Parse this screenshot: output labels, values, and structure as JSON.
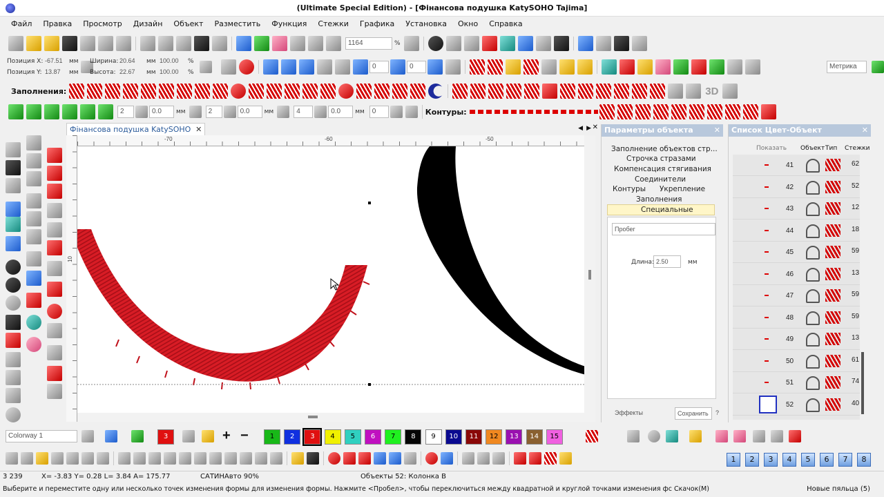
{
  "app": {
    "title": "(Ultimate Special Edition) - [Фінансова подушка KatySOHO        Tajima]"
  },
  "menu": [
    "Файл",
    "Правка",
    "Просмотр",
    "Дизайн",
    "Объект",
    "Разместить",
    "Функция",
    "Стежки",
    "Графика",
    "Установка",
    "Окно",
    "Справка"
  ],
  "toolbar1": {
    "zoom_value": "1164",
    "zoom_unit": "%"
  },
  "toolbar2": {
    "pos_x_label": "Позиция X:",
    "pos_x": "-67.51",
    "pos_x_unit": "мм",
    "pos_y_label": "Позиция Y:",
    "pos_y": "13.87",
    "pos_y_unit": "мм",
    "width_label": "Ширина:",
    "width": "20.64",
    "width_unit": "мм",
    "width_pct": "100.00",
    "width_pct_unit": "%",
    "height_label": "Высота:",
    "height": "22.67",
    "height_unit": "мм",
    "height_pct": "100.00",
    "height_pct_unit": "%",
    "rotate_value": "0",
    "slant_value": "0",
    "units_select": "Метрика"
  },
  "toolbar3": {
    "fills_label": "Заполнения:",
    "label_3d": "3D"
  },
  "toolbar4": {
    "field1": "2",
    "field2": "0.0",
    "field2_unit": "мм",
    "field3": "2",
    "field4": "0.0",
    "field4_unit": "мм",
    "field5": "4",
    "field6": "0.0",
    "field6_unit": "мм",
    "field7": "0",
    "contours_label": "Контуры:"
  },
  "document": {
    "tab_label": "Фінансова подушка KatySOHO",
    "ruler_h": [
      "-70",
      "-60",
      "-50"
    ],
    "ruler_v": [
      "10"
    ]
  },
  "object_params": {
    "title": "Параметры объекта",
    "tabs": [
      "Заполнение объектов стр...",
      "Строчка стразами",
      "Компенсация стягивания",
      "Соединители",
      "Контуры",
      "Укрепление",
      "Заполнения",
      "Специальные"
    ],
    "selected_tab": "Специальные",
    "type_select": "Пробег",
    "length_label": "Длина:",
    "length_value": "2.50",
    "length_unit": "мм",
    "effects_button": "Эффекты",
    "save_button": "Сохранить",
    "help_button": "?"
  },
  "color_list": {
    "title": "Список Цвет-Объект",
    "columns": [
      "Показать",
      "Объект",
      "Тип",
      "Стежки"
    ],
    "rows": [
      {
        "num": "41",
        "stitches": "62"
      },
      {
        "num": "42",
        "stitches": "52"
      },
      {
        "num": "43",
        "stitches": "12"
      },
      {
        "num": "44",
        "stitches": "18"
      },
      {
        "num": "45",
        "stitches": "59"
      },
      {
        "num": "46",
        "stitches": "13"
      },
      {
        "num": "47",
        "stitches": "59"
      },
      {
        "num": "48",
        "stitches": "59"
      },
      {
        "num": "49",
        "stitches": "13"
      },
      {
        "num": "50",
        "stitches": "61"
      },
      {
        "num": "51",
        "stitches": "74"
      },
      {
        "num": "52",
        "stitches": "40"
      }
    ]
  },
  "palette": {
    "colorway": "Colorway 1",
    "current_color": "3",
    "swatches": [
      {
        "label": "1",
        "color": "#18b818",
        "text": "#000"
      },
      {
        "label": "2",
        "color": "#1030e0",
        "text": "#fff"
      },
      {
        "label": "3",
        "color": "#e01010",
        "text": "#fff"
      },
      {
        "label": "4",
        "color": "#f0f000",
        "text": "#000"
      },
      {
        "label": "5",
        "color": "#30d0c0",
        "text": "#000"
      },
      {
        "label": "6",
        "color": "#c010c0",
        "text": "#fff"
      },
      {
        "label": "7",
        "color": "#20f020",
        "text": "#000"
      },
      {
        "label": "8",
        "color": "#050505",
        "text": "#fff"
      },
      {
        "label": "9",
        "color": "#ffffff",
        "text": "#000"
      },
      {
        "label": "10",
        "color": "#0a0a90",
        "text": "#fff"
      },
      {
        "label": "11",
        "color": "#8a0808",
        "text": "#fff"
      },
      {
        "label": "12",
        "color": "#f08820",
        "text": "#000"
      },
      {
        "label": "13",
        "color": "#9a10b0",
        "text": "#fff"
      },
      {
        "label": "14",
        "color": "#8a6030",
        "text": "#fff"
      },
      {
        "label": "15",
        "color": "#f060e0",
        "text": "#000"
      }
    ]
  },
  "bottom_numbers": [
    "1",
    "2",
    "3",
    "4",
    "5",
    "6",
    "7",
    "8"
  ],
  "status": {
    "count": "3 239",
    "coords": "X=  -3.83 Y=    0.28 L=    3.84 A= 175.77",
    "mode": "САТИНАвто 90%",
    "objects": "Объекты 52: Колонка B",
    "hint": "Выберите и переместите одну или несколько точек изменения формы для изменения формы. Нажмите <Пробел>, чтобы переключиться между квадратной и круглой точками изменения фс  Скачок(М)",
    "hoop": "Новые пяльца (5)"
  }
}
